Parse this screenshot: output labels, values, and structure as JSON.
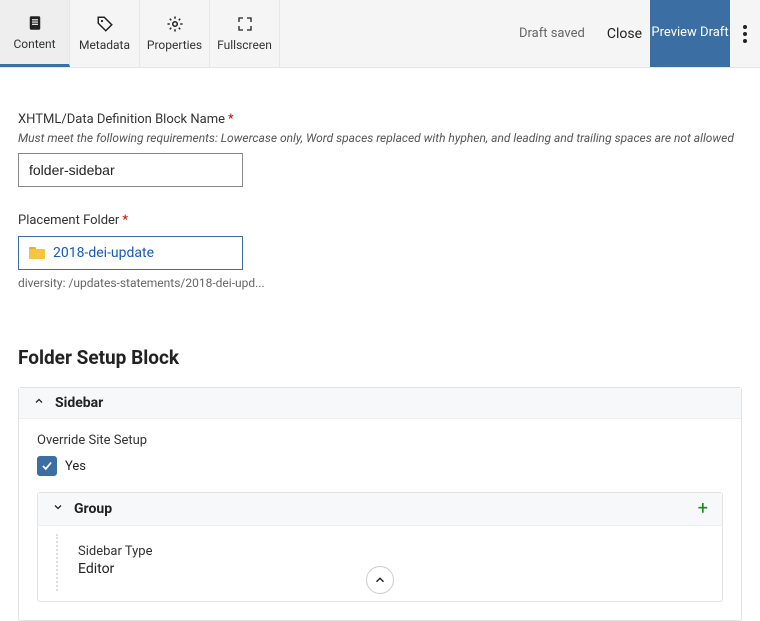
{
  "tabs": [
    {
      "label": "Content",
      "icon": "document-icon"
    },
    {
      "label": "Metadata",
      "icon": "tag-icon"
    },
    {
      "label": "Properties",
      "icon": "gear-icon"
    },
    {
      "label": "Fullscreen",
      "icon": "fullscreen-icon"
    }
  ],
  "header": {
    "status": "Draft saved",
    "close": "Close",
    "preview": "Preview Draft"
  },
  "form": {
    "blockNameLabel": "XHTML/Data Definition Block Name",
    "blockNameHint": "Must meet the following requirements: Lowercase only, Word spaces replaced with hyphen, and leading and trailing spaces are not allowed",
    "blockNameValue": "folder-sidebar",
    "placementLabel": "Placement Folder",
    "placementValue": "2018-dei-update",
    "placementPath": "diversity: /updates-statements/2018-dei-upd..."
  },
  "setup": {
    "sectionTitle": "Folder Setup Block",
    "panelTitle": "Sidebar",
    "overrideLabel": "Override Site Setup",
    "overrideValue": "Yes",
    "group": {
      "title": "Group",
      "fieldName": "Sidebar Type",
      "fieldValue": "Editor"
    }
  }
}
